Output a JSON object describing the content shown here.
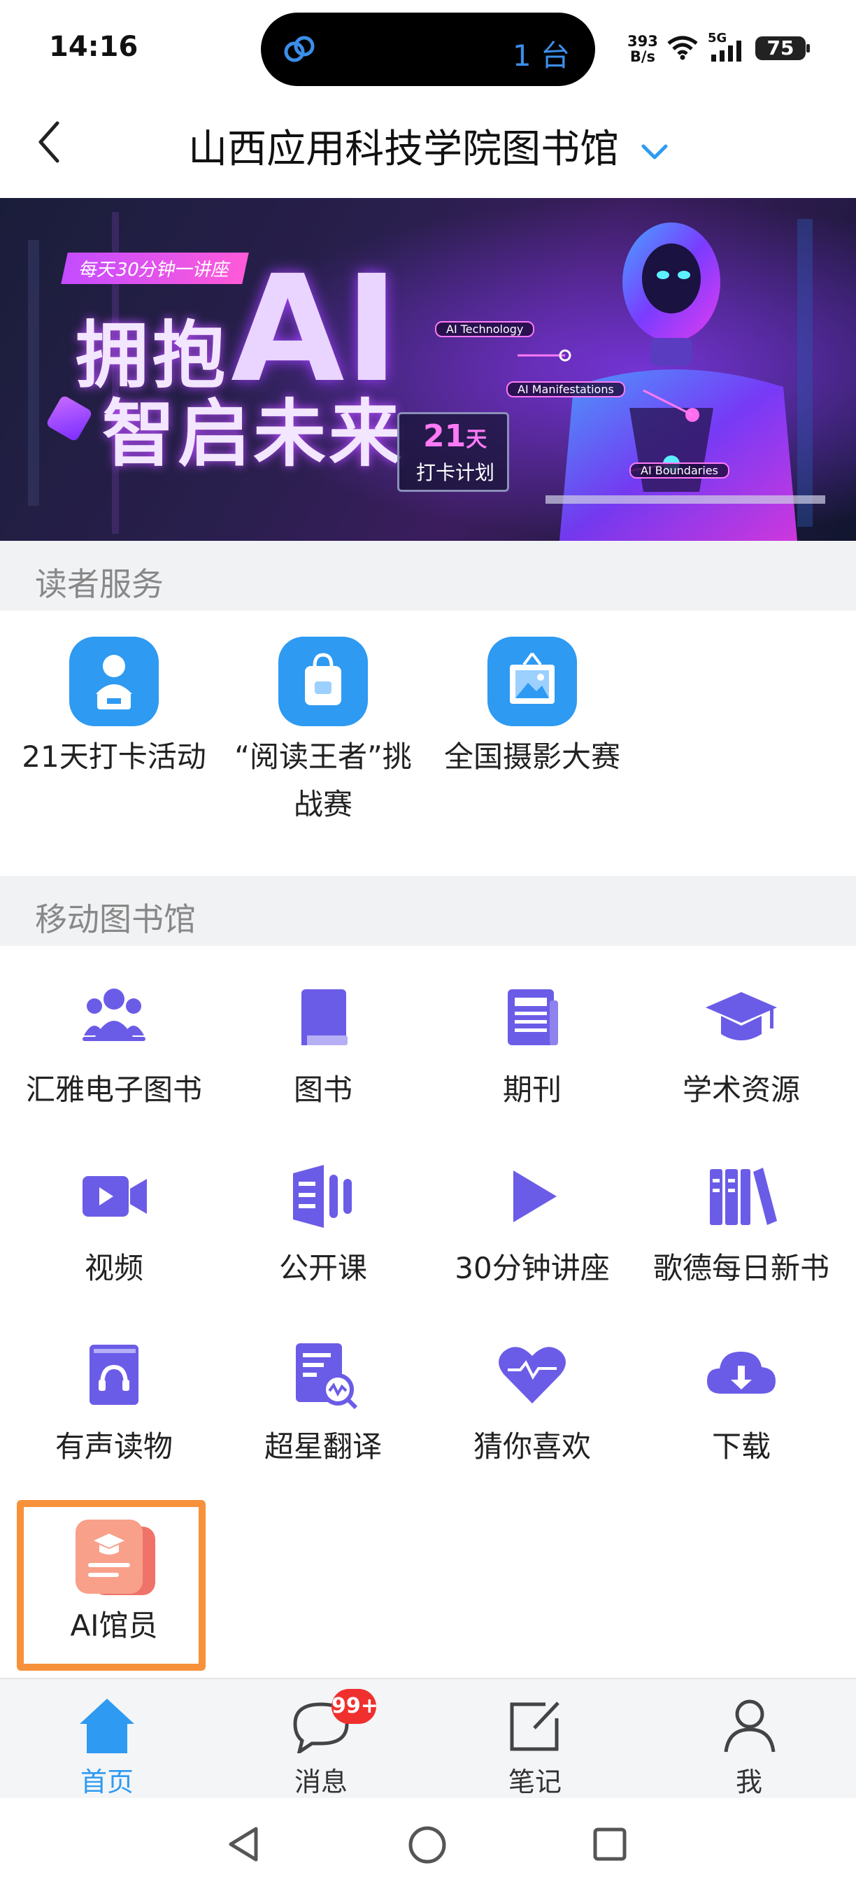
{
  "status_bar": {
    "time": "14:16",
    "island_count": "1 台",
    "speed_value": "393",
    "speed_unit": "B/s",
    "network": "5G",
    "battery": "75"
  },
  "header": {
    "title": "山西应用科技学院图书馆"
  },
  "banner": {
    "tag": "每天30分钟一讲座",
    "headline_1": "拥抱",
    "headline_ai": "AI",
    "headline_2": "智启未来",
    "badge_number": "21",
    "badge_unit": "天",
    "badge_text": "打卡计划",
    "label_1": "AI Technology",
    "label_2": "AI Manifestations",
    "label_3": "AI Boundaries"
  },
  "reader_services": {
    "title": "读者服务",
    "items": [
      {
        "label": "21天打卡活动",
        "icon": "presenter-icon"
      },
      {
        "label_line1": "“阅读王者”挑",
        "label_line2": "战赛",
        "icon": "shopping-bag-icon"
      },
      {
        "label": "全国摄影大赛",
        "icon": "picture-frame-icon"
      }
    ]
  },
  "mobile_library": {
    "title": "移动图书馆",
    "items": [
      {
        "label": "汇雅电子图书",
        "icon": "people-group-icon"
      },
      {
        "label": "图书",
        "icon": "book-icon"
      },
      {
        "label": "期刊",
        "icon": "newspaper-icon"
      },
      {
        "label": "学术资源",
        "icon": "graduation-cap-icon"
      },
      {
        "label": "视频",
        "icon": "video-camera-icon"
      },
      {
        "label": "公开课",
        "icon": "open-course-icon"
      },
      {
        "label": "30分钟讲座",
        "icon": "play-icon"
      },
      {
        "label": "歌德每日新书",
        "icon": "bookshelf-icon"
      },
      {
        "label": "有声读物",
        "icon": "audiobook-icon"
      },
      {
        "label": "超星翻译",
        "icon": "translate-doc-icon"
      },
      {
        "label": "猜你喜欢",
        "icon": "heart-pulse-icon"
      },
      {
        "label": "下载",
        "icon": "cloud-download-icon"
      },
      {
        "label": "AI馆员",
        "icon": "ai-librarian-icon"
      }
    ]
  },
  "tabbar": {
    "tabs": [
      {
        "label": "首页",
        "icon": "home-icon",
        "active": true
      },
      {
        "label": "消息",
        "icon": "message-icon",
        "badge": "99+"
      },
      {
        "label": "笔记",
        "icon": "note-edit-icon"
      },
      {
        "label": "我",
        "icon": "user-icon"
      }
    ]
  },
  "colors": {
    "accent_blue": "#2e9af2",
    "icon_purple": "#6b5ce7",
    "highlight_orange": "#f7913a",
    "badge_red": "#f0302e",
    "section_bg": "#f1f2f4"
  }
}
